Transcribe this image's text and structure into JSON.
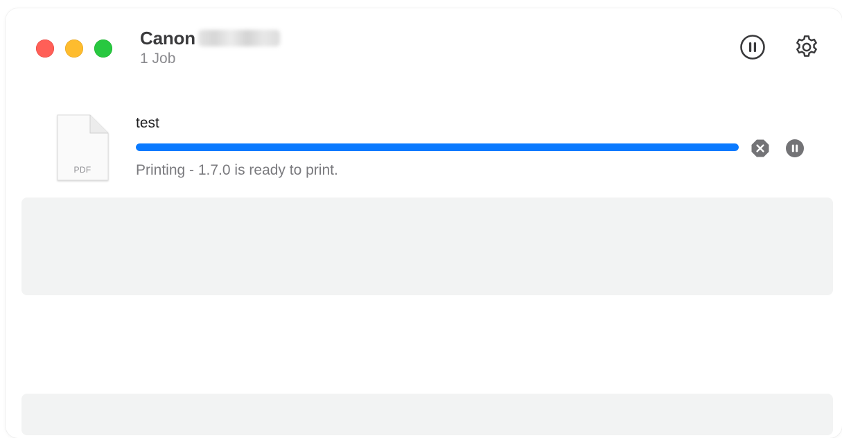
{
  "window": {
    "printer_name": "Canon",
    "job_count": "1 Job"
  },
  "toolbar": {
    "pause_icon": "pause-circle-icon",
    "settings_icon": "gear-icon"
  },
  "job": {
    "name": "test",
    "file_type": "PDF",
    "status": "Printing - 1.7.0 is ready to print.",
    "progress": 1.0,
    "cancel_icon": "cancel-x-icon",
    "pause_icon": "pause-icon"
  },
  "colors": {
    "close": "#ff5f57",
    "minimize": "#febc2e",
    "zoom": "#28c840",
    "progress": "#0a7aff",
    "panel": "#f2f3f3"
  }
}
